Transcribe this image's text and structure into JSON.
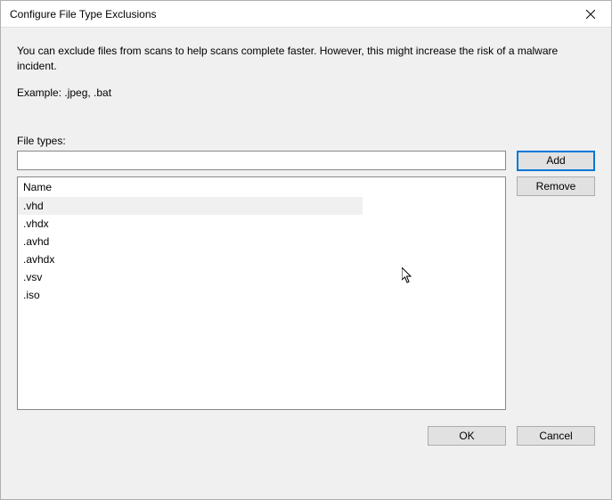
{
  "title": "Configure File Type Exclusions",
  "description": "You can exclude files from scans to help scans complete faster. However, this might increase the risk of a malware incident.",
  "example": "Example: .jpeg, .bat",
  "fileTypesLabel": "File types:",
  "inputValue": "",
  "addLabel": "Add",
  "removeLabel": "Remove",
  "columnHeader": "Name",
  "items": [
    {
      "label": ".vhd",
      "selected": true
    },
    {
      "label": ".vhdx",
      "selected": false
    },
    {
      "label": ".avhd",
      "selected": false
    },
    {
      "label": ".avhdx",
      "selected": false
    },
    {
      "label": ".vsv",
      "selected": false
    },
    {
      "label": ".iso",
      "selected": false
    }
  ],
  "okLabel": "OK",
  "cancelLabel": "Cancel"
}
